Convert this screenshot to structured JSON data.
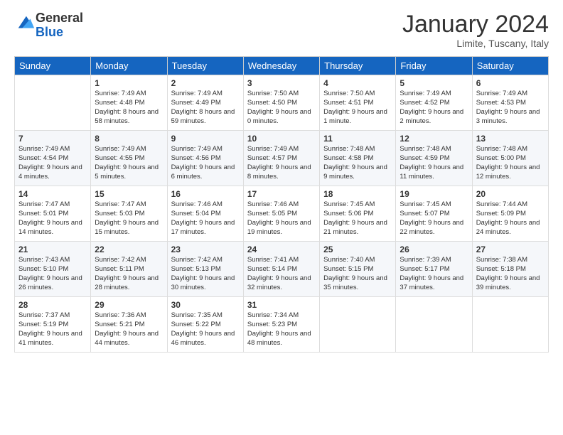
{
  "logo": {
    "general": "General",
    "blue": "Blue"
  },
  "header": {
    "month": "January 2024",
    "location": "Limite, Tuscany, Italy"
  },
  "days": [
    "Sunday",
    "Monday",
    "Tuesday",
    "Wednesday",
    "Thursday",
    "Friday",
    "Saturday"
  ],
  "weeks": [
    [
      {
        "day": "",
        "sunrise": "",
        "sunset": "",
        "daylight": ""
      },
      {
        "day": "1",
        "sunrise": "Sunrise: 7:49 AM",
        "sunset": "Sunset: 4:48 PM",
        "daylight": "Daylight: 8 hours and 58 minutes."
      },
      {
        "day": "2",
        "sunrise": "Sunrise: 7:49 AM",
        "sunset": "Sunset: 4:49 PM",
        "daylight": "Daylight: 8 hours and 59 minutes."
      },
      {
        "day": "3",
        "sunrise": "Sunrise: 7:50 AM",
        "sunset": "Sunset: 4:50 PM",
        "daylight": "Daylight: 9 hours and 0 minutes."
      },
      {
        "day": "4",
        "sunrise": "Sunrise: 7:50 AM",
        "sunset": "Sunset: 4:51 PM",
        "daylight": "Daylight: 9 hours and 1 minute."
      },
      {
        "day": "5",
        "sunrise": "Sunrise: 7:49 AM",
        "sunset": "Sunset: 4:52 PM",
        "daylight": "Daylight: 9 hours and 2 minutes."
      },
      {
        "day": "6",
        "sunrise": "Sunrise: 7:49 AM",
        "sunset": "Sunset: 4:53 PM",
        "daylight": "Daylight: 9 hours and 3 minutes."
      }
    ],
    [
      {
        "day": "7",
        "sunrise": "Sunrise: 7:49 AM",
        "sunset": "Sunset: 4:54 PM",
        "daylight": "Daylight: 9 hours and 4 minutes."
      },
      {
        "day": "8",
        "sunrise": "Sunrise: 7:49 AM",
        "sunset": "Sunset: 4:55 PM",
        "daylight": "Daylight: 9 hours and 5 minutes."
      },
      {
        "day": "9",
        "sunrise": "Sunrise: 7:49 AM",
        "sunset": "Sunset: 4:56 PM",
        "daylight": "Daylight: 9 hours and 6 minutes."
      },
      {
        "day": "10",
        "sunrise": "Sunrise: 7:49 AM",
        "sunset": "Sunset: 4:57 PM",
        "daylight": "Daylight: 9 hours and 8 minutes."
      },
      {
        "day": "11",
        "sunrise": "Sunrise: 7:48 AM",
        "sunset": "Sunset: 4:58 PM",
        "daylight": "Daylight: 9 hours and 9 minutes."
      },
      {
        "day": "12",
        "sunrise": "Sunrise: 7:48 AM",
        "sunset": "Sunset: 4:59 PM",
        "daylight": "Daylight: 9 hours and 11 minutes."
      },
      {
        "day": "13",
        "sunrise": "Sunrise: 7:48 AM",
        "sunset": "Sunset: 5:00 PM",
        "daylight": "Daylight: 9 hours and 12 minutes."
      }
    ],
    [
      {
        "day": "14",
        "sunrise": "Sunrise: 7:47 AM",
        "sunset": "Sunset: 5:01 PM",
        "daylight": "Daylight: 9 hours and 14 minutes."
      },
      {
        "day": "15",
        "sunrise": "Sunrise: 7:47 AM",
        "sunset": "Sunset: 5:03 PM",
        "daylight": "Daylight: 9 hours and 15 minutes."
      },
      {
        "day": "16",
        "sunrise": "Sunrise: 7:46 AM",
        "sunset": "Sunset: 5:04 PM",
        "daylight": "Daylight: 9 hours and 17 minutes."
      },
      {
        "day": "17",
        "sunrise": "Sunrise: 7:46 AM",
        "sunset": "Sunset: 5:05 PM",
        "daylight": "Daylight: 9 hours and 19 minutes."
      },
      {
        "day": "18",
        "sunrise": "Sunrise: 7:45 AM",
        "sunset": "Sunset: 5:06 PM",
        "daylight": "Daylight: 9 hours and 21 minutes."
      },
      {
        "day": "19",
        "sunrise": "Sunrise: 7:45 AM",
        "sunset": "Sunset: 5:07 PM",
        "daylight": "Daylight: 9 hours and 22 minutes."
      },
      {
        "day": "20",
        "sunrise": "Sunrise: 7:44 AM",
        "sunset": "Sunset: 5:09 PM",
        "daylight": "Daylight: 9 hours and 24 minutes."
      }
    ],
    [
      {
        "day": "21",
        "sunrise": "Sunrise: 7:43 AM",
        "sunset": "Sunset: 5:10 PM",
        "daylight": "Daylight: 9 hours and 26 minutes."
      },
      {
        "day": "22",
        "sunrise": "Sunrise: 7:42 AM",
        "sunset": "Sunset: 5:11 PM",
        "daylight": "Daylight: 9 hours and 28 minutes."
      },
      {
        "day": "23",
        "sunrise": "Sunrise: 7:42 AM",
        "sunset": "Sunset: 5:13 PM",
        "daylight": "Daylight: 9 hours and 30 minutes."
      },
      {
        "day": "24",
        "sunrise": "Sunrise: 7:41 AM",
        "sunset": "Sunset: 5:14 PM",
        "daylight": "Daylight: 9 hours and 32 minutes."
      },
      {
        "day": "25",
        "sunrise": "Sunrise: 7:40 AM",
        "sunset": "Sunset: 5:15 PM",
        "daylight": "Daylight: 9 hours and 35 minutes."
      },
      {
        "day": "26",
        "sunrise": "Sunrise: 7:39 AM",
        "sunset": "Sunset: 5:17 PM",
        "daylight": "Daylight: 9 hours and 37 minutes."
      },
      {
        "day": "27",
        "sunrise": "Sunrise: 7:38 AM",
        "sunset": "Sunset: 5:18 PM",
        "daylight": "Daylight: 9 hours and 39 minutes."
      }
    ],
    [
      {
        "day": "28",
        "sunrise": "Sunrise: 7:37 AM",
        "sunset": "Sunset: 5:19 PM",
        "daylight": "Daylight: 9 hours and 41 minutes."
      },
      {
        "day": "29",
        "sunrise": "Sunrise: 7:36 AM",
        "sunset": "Sunset: 5:21 PM",
        "daylight": "Daylight: 9 hours and 44 minutes."
      },
      {
        "day": "30",
        "sunrise": "Sunrise: 7:35 AM",
        "sunset": "Sunset: 5:22 PM",
        "daylight": "Daylight: 9 hours and 46 minutes."
      },
      {
        "day": "31",
        "sunrise": "Sunrise: 7:34 AM",
        "sunset": "Sunset: 5:23 PM",
        "daylight": "Daylight: 9 hours and 48 minutes."
      },
      {
        "day": "",
        "sunrise": "",
        "sunset": "",
        "daylight": ""
      },
      {
        "day": "",
        "sunrise": "",
        "sunset": "",
        "daylight": ""
      },
      {
        "day": "",
        "sunrise": "",
        "sunset": "",
        "daylight": ""
      }
    ]
  ]
}
